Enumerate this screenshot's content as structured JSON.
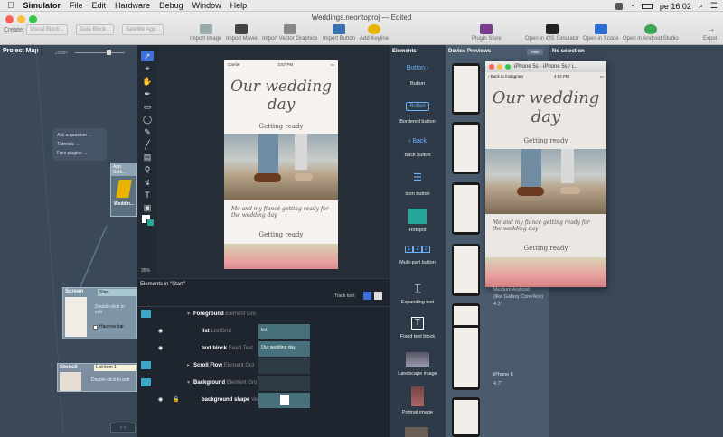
{
  "menubar": {
    "apple": "",
    "app": "Simulator",
    "items": [
      "File",
      "Edit",
      "Hardware",
      "Debug",
      "Window",
      "Help"
    ],
    "clock": "pe 16.02"
  },
  "toolbar": {
    "doc_title": "Weddings.neontoproj — Edited",
    "create_label": "Create:",
    "templates": [
      "Visual Block...",
      "Data Block...",
      "Satellite App..."
    ],
    "buttons": [
      "Import Image",
      "Import Movie",
      "Import Vector Graphics",
      "Import Button",
      "Add Keyline",
      "Plugin Store",
      "Open in iOS Simulator",
      "Open in Xcode",
      "Open in Android Studio",
      "Export"
    ]
  },
  "project_map": {
    "title": "Project Map",
    "zoom_label": "Zoom:",
    "bubble": [
      "Ask a question →",
      "Tutorials →",
      "Free plugins →"
    ],
    "app_settings": "App Setti...",
    "app_name": "Weddin...",
    "screen_label": "Screen",
    "start_label": "Start",
    "double_click": "Double-click to edit",
    "has_nav_bar": "Has nav bar",
    "stencil_label": "Stencil",
    "list_item_label": "List item 1",
    "stencil_hint": "Double-click to edit"
  },
  "canvas": {
    "carrier": "Carrier",
    "time": "3:57 PM",
    "title": "Our wedding day",
    "subtitle": "Getting ready",
    "body": "Me and my fiancé getting ready for the wedding day",
    "subtitle2": "Getting ready",
    "zoom": "35%"
  },
  "elements_tree": {
    "title": "Elements in \"Start\"",
    "track_tool": "Track tool:",
    "rows": [
      {
        "name": "Foreground",
        "type": "Element Gro"
      },
      {
        "name": "list",
        "type": "List/Grid",
        "value": "list"
      },
      {
        "name": "text block",
        "type": "Fixed Text",
        "value": "Our wedding day"
      },
      {
        "name": "Scroll Flow",
        "type": "Element Gro"
      },
      {
        "name": "Background",
        "type": "Element Gro"
      },
      {
        "name": "background shape",
        "type": "Ve"
      }
    ]
  },
  "elements": {
    "title": "Elements",
    "items": [
      "Button",
      "Bordered button",
      "Back button",
      "Icon button",
      "Hotspot",
      "Multi-part button",
      "Expanding text",
      "Fixed text block",
      "Landscape image",
      "Portrait image"
    ],
    "button_glyph": "Button",
    "bordered_glyph": "Button",
    "back_glyph": "Back",
    "multipart_glyphs": [
      "1",
      "2",
      "3"
    ]
  },
  "device_previews": {
    "title": "Device Previews",
    "hide": "Hide",
    "medium_android": "Medium Android",
    "medium_android_sub": "(like Galaxy Core/Ace)",
    "android_size": "4.3\"",
    "iphone6": "iPhone 6",
    "iphone6_size": "4.7\""
  },
  "simulator": {
    "title": "iPhone 5s - iPhone 5s / i...",
    "back": "Back to Instagram",
    "time": "4:02 PM",
    "heading": "Our wedding day",
    "sub": "Getting ready",
    "body": "Me and my fiancé getting ready for the wedding day",
    "sub2": "Getting ready"
  },
  "no_selection": {
    "title": "No selection"
  },
  "colors": {
    "accent": "#45707c",
    "panel": "#2e3a48",
    "hotspot": "#26a59a"
  }
}
